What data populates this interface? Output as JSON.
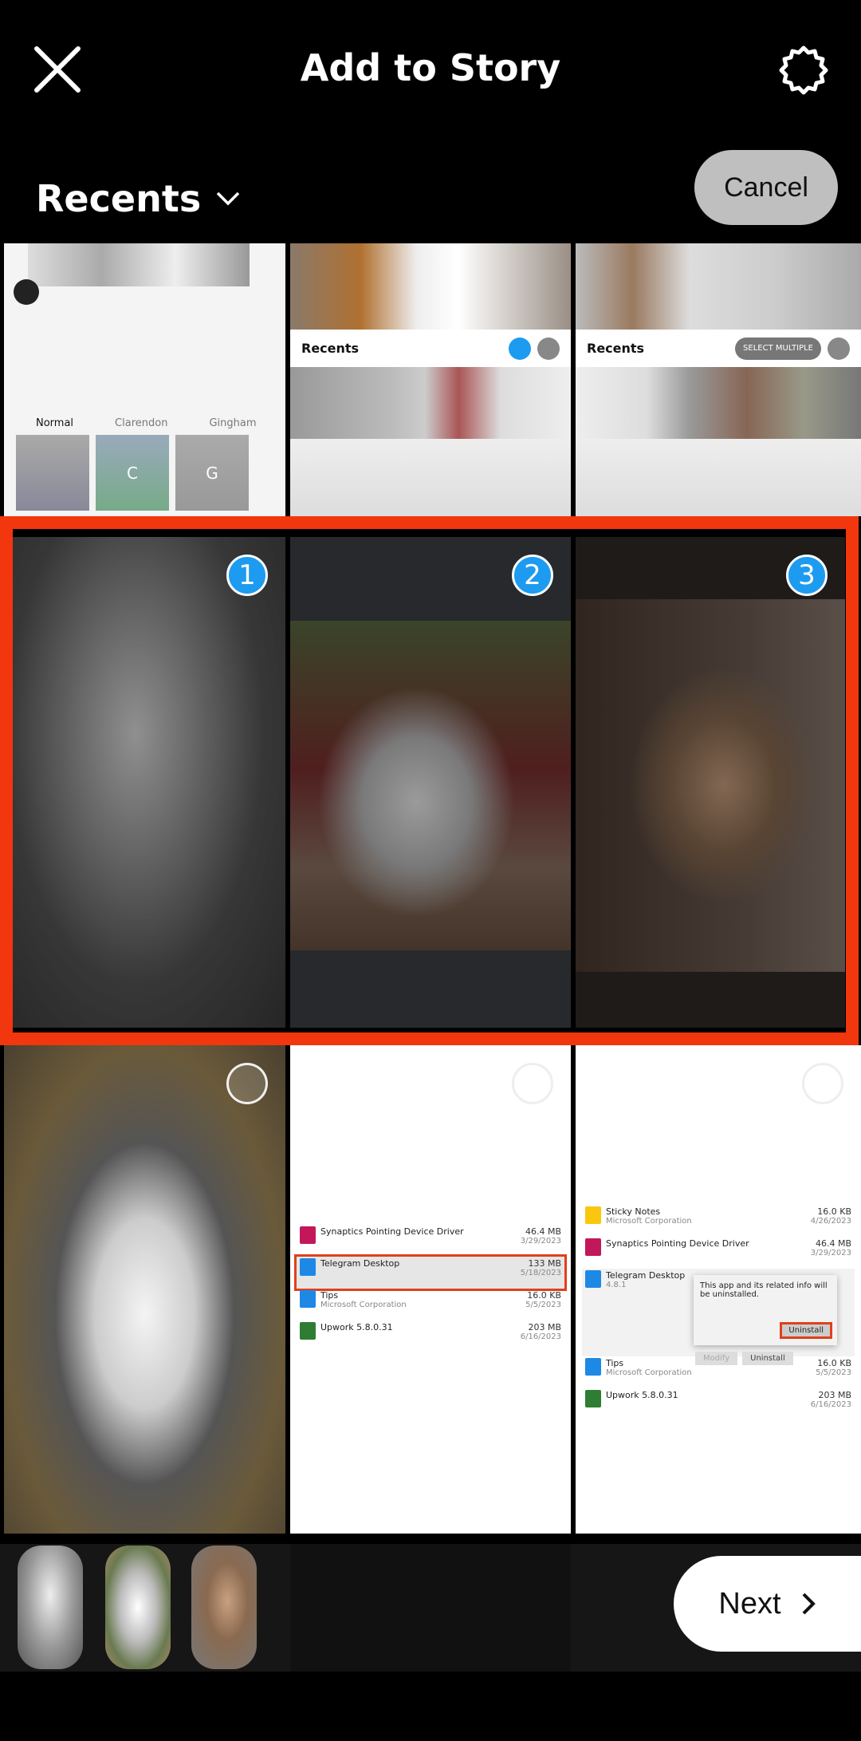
{
  "header": {
    "title": "Add to Story",
    "close_icon": "close-icon",
    "settings_icon": "gear-icon"
  },
  "album": {
    "label": "Recents",
    "cancel_label": "Cancel"
  },
  "row1": {
    "filters": [
      "Normal",
      "Clarendon",
      "Gingham"
    ],
    "filter_letters": [
      "C",
      "G"
    ],
    "mini_recents": "Recents",
    "select_multiple": "SELECT MULTIPLE"
  },
  "selected": [
    {
      "number": "1"
    },
    {
      "number": "2"
    },
    {
      "number": "3"
    }
  ],
  "apps_left": [
    {
      "name": "Synaptics Pointing Device Driver",
      "sub": "",
      "size": "46.4 MB",
      "date": "3/29/2023"
    },
    {
      "name": "Telegram Desktop",
      "sub": "",
      "size": "133 MB",
      "date": "5/18/2023"
    },
    {
      "name": "Tips",
      "sub": "Microsoft Corporation",
      "size": "16.0 KB",
      "date": "5/5/2023"
    },
    {
      "name": "Upwork 5.8.0.31",
      "sub": "",
      "size": "203 MB",
      "date": "6/16/2023"
    }
  ],
  "apps_right": [
    {
      "name": "Sticky Notes",
      "sub": "Microsoft Corporation",
      "size": "16.0 KB",
      "date": "4/26/2023"
    },
    {
      "name": "Synaptics Pointing Device Driver",
      "sub": "",
      "size": "46.4 MB",
      "date": "3/29/2023"
    },
    {
      "name": "Telegram Desktop",
      "sub": "4.8.1",
      "size": "",
      "date": ""
    },
    {
      "name": "Tips",
      "sub": "Microsoft Corporation",
      "size": "16.0 KB",
      "date": "5/5/2023"
    },
    {
      "name": "Upwork 5.8.0.31",
      "sub": "",
      "size": "203 MB",
      "date": "6/16/2023"
    }
  ],
  "dialog": {
    "text": "This app and its related info will be uninstalled.",
    "uninstall": "Uninstall",
    "modify": "Modify",
    "uninstall2": "Uninstall"
  },
  "next_label": "Next",
  "colors": {
    "accent": "#1d9bf0",
    "highlight": "#f2360e",
    "cancel_bg": "#bfbfbf"
  }
}
